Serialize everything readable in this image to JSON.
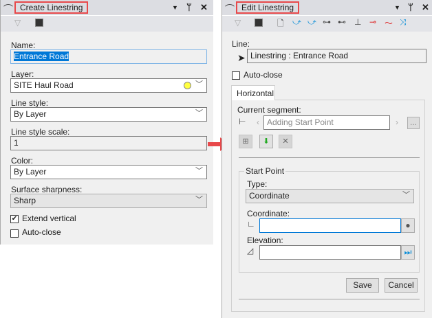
{
  "create_panel": {
    "title": "Create Linestring",
    "fields": {
      "name_label": "Name:",
      "name_value": "Entrance Road",
      "layer_label": "Layer:",
      "layer_value": "SITE Haul Road",
      "line_style_label": "Line style:",
      "line_style_value": "By Layer",
      "line_style_scale_label": "Line style scale:",
      "line_style_scale_value": "1",
      "color_label": "Color:",
      "color_value": "By Layer",
      "surface_sharpness_label": "Surface sharpness:",
      "surface_sharpness_value": "Sharp",
      "extend_vertical_label": "Extend vertical",
      "extend_vertical_checked": true,
      "auto_close_label": "Auto-close",
      "auto_close_checked": false
    }
  },
  "edit_panel": {
    "title": "Edit Linestring",
    "line_label": "Line:",
    "line_value": "Linestring : Entrance Road",
    "auto_close_label": "Auto-close",
    "tab_label": "Horizontal",
    "current_segment_label": "Current segment:",
    "segment_value": "Adding Start Point",
    "more_button": "...",
    "group_title": "Start Point",
    "type_label": "Type:",
    "type_value": "Coordinate",
    "coordinate_label": "Coordinate:",
    "coordinate_value": "",
    "elevation_label": "Elevation:",
    "elevation_value": "",
    "save_label": "Save",
    "cancel_label": "Cancel"
  },
  "colors": {
    "highlight": "#e8484a",
    "selection": "#0078d7",
    "layer_swatch": "#ffff40"
  }
}
